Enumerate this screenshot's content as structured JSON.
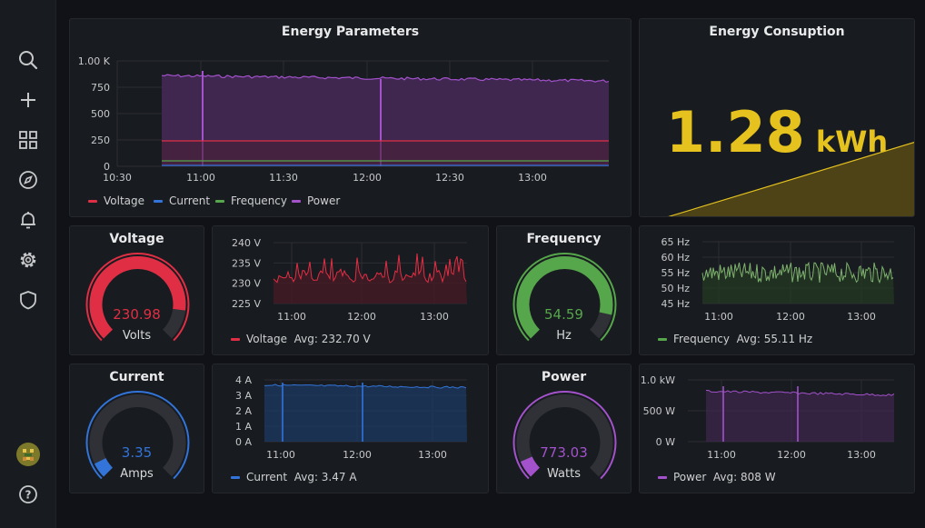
{
  "colors": {
    "voltage": "#e02f44",
    "current": "#3274d9",
    "frequency": "#56a64b",
    "power": "#a352cc",
    "energy": "#e5c21e",
    "grid": "#2c2e33",
    "axis": "#c7c8ca"
  },
  "sidebar": {
    "icons": [
      "search-icon",
      "plus-icon",
      "dashboards-icon",
      "explore-icon",
      "alerting-icon",
      "settings-icon",
      "shield-icon",
      "avatar",
      "help-icon"
    ]
  },
  "energy_params": {
    "title": "Energy Parameters",
    "yticks": [
      "1.00 K",
      "750",
      "500",
      "250",
      "0"
    ],
    "xticks": [
      "10:30",
      "11:00",
      "11:30",
      "12:00",
      "12:30",
      "13:00"
    ],
    "legend": [
      "Voltage",
      "Current",
      "Frequency",
      "Power"
    ]
  },
  "energy_consumption": {
    "title": "Energy Consuption",
    "value": "1.28",
    "unit": "kWh"
  },
  "voltage_gauge": {
    "title": "Voltage",
    "value": "230.98",
    "unit": "Volts",
    "fill": 0.86
  },
  "voltage_chart": {
    "yticks": [
      "240 V",
      "235 V",
      "230 V",
      "225 V"
    ],
    "xticks": [
      "11:00",
      "12:00",
      "13:00"
    ],
    "legend": "Voltage",
    "avg": "Avg: 232.70 V"
  },
  "frequency_gauge": {
    "title": "Frequency",
    "value": "54.59",
    "unit": "Hz",
    "fill": 0.88
  },
  "frequency_chart": {
    "yticks": [
      "65 Hz",
      "60 Hz",
      "55 Hz",
      "50 Hz",
      "45 Hz"
    ],
    "xticks": [
      "11:00",
      "12:00",
      "13:00"
    ],
    "legend": "Frequency",
    "avg": "Avg: 55.11 Hz"
  },
  "current_gauge": {
    "title": "Current",
    "value": "3.35",
    "unit": "Amps",
    "fill": 0.07
  },
  "current_chart": {
    "yticks": [
      "4 A",
      "3 A",
      "2 A",
      "1 A",
      "0 A"
    ],
    "xticks": [
      "11:00",
      "12:00",
      "13:00"
    ],
    "legend": "Current",
    "avg": "Avg: 3.47 A"
  },
  "power_gauge": {
    "title": "Power",
    "value": "773.03",
    "unit": "Watts",
    "fill": 0.08
  },
  "power_chart": {
    "yticks": [
      "1.0 kW",
      "500 W",
      "0 W"
    ],
    "xticks": [
      "11:00",
      "12:00",
      "13:00"
    ],
    "legend": "Power",
    "avg": "Avg: 808 W"
  }
}
